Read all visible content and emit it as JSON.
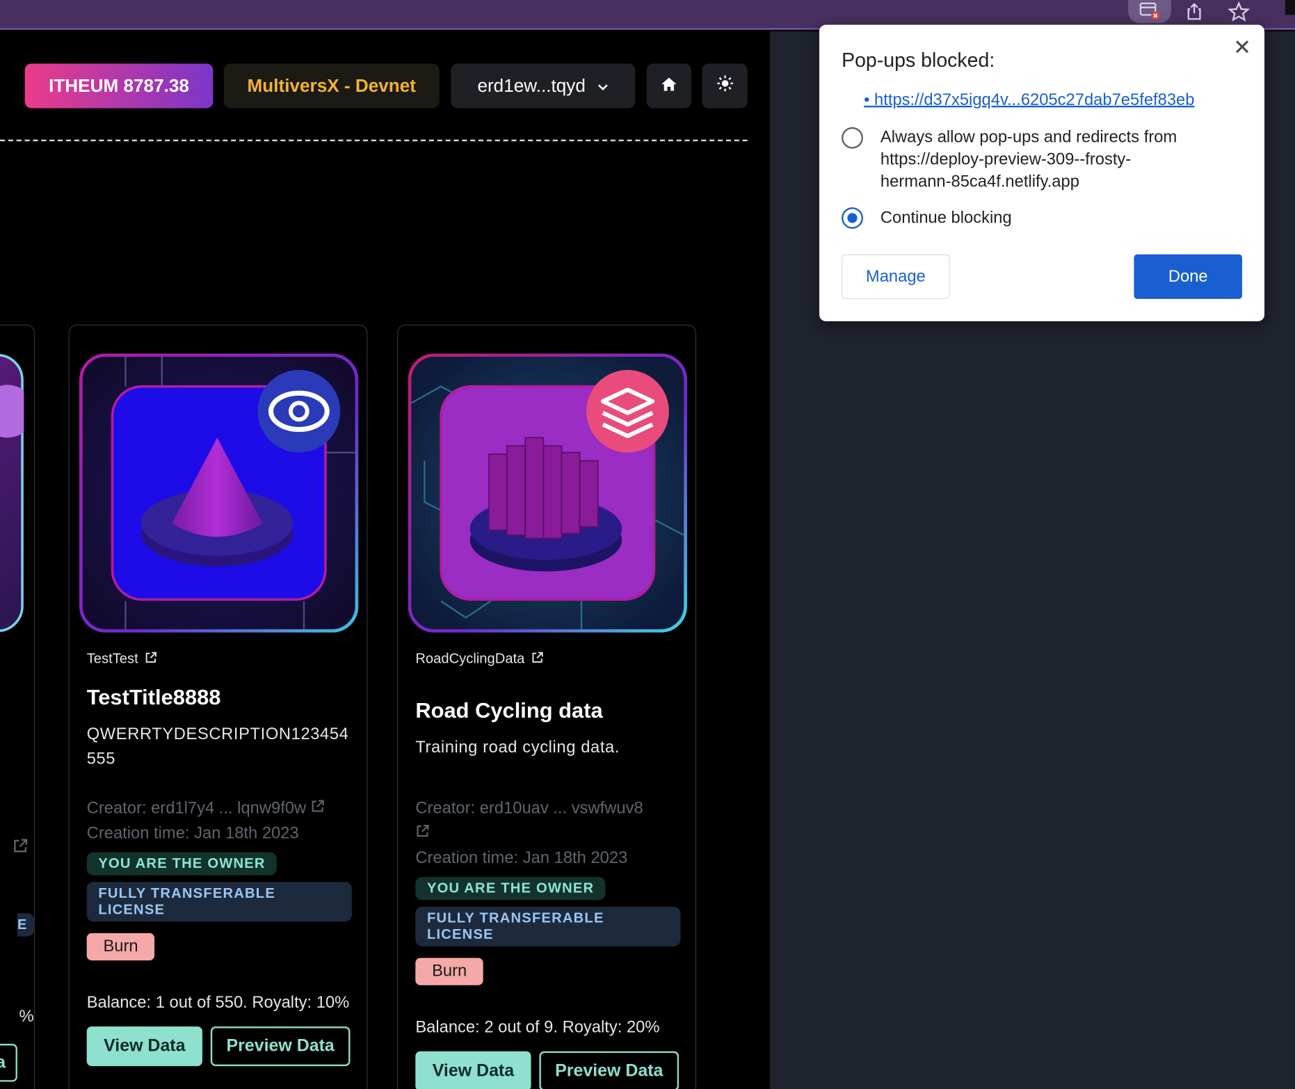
{
  "toolbar": {
    "icons": [
      "popup-blocked-icon",
      "share-icon",
      "bookmark-star-icon"
    ],
    "accent": "#47305f"
  },
  "header": {
    "itheum_balance": "ITHEUM 8787.38",
    "network": "MultiversX - Devnet",
    "wallet": "erd1ew...tqyd"
  },
  "cards": [
    {
      "token": "TestTest",
      "title": "TestTitle8888",
      "description": "QWERRTYDESCRIPTION123454555",
      "creator": "Creator: erd1l7y4 ... lqnw9f0w",
      "creation_time": "Creation time: Jan 18th 2023",
      "owner_badge": "YOU ARE THE OWNER",
      "license_badge": "FULLY TRANSFERABLE LICENSE",
      "burn": "Burn",
      "balance": "Balance: 1 out of 550. Royalty: 10%",
      "view": "View Data",
      "preview": "Preview Data"
    },
    {
      "token": "RoadCyclingData",
      "title": "Road Cycling data",
      "description": "Training road cycling data.",
      "creator": "Creator: erd10uav ... vswfwuv8",
      "creation_time": "Creation time: Jan 18th 2023",
      "owner_badge": "YOU ARE THE OWNER",
      "license_badge": "FULLY TRANSFERABLE LICENSE",
      "burn": "Burn",
      "balance": "Balance: 2 out of 9. Royalty: 20%",
      "view": "View Data",
      "preview": "Preview Data"
    }
  ],
  "partial_card": {
    "license_fragment": "E",
    "royalty_fragment": "%",
    "button_fragment": "a"
  },
  "popup": {
    "title": "Pop-ups blocked:",
    "blocked_link": "https://d37x5igq4v...6205c27dab7e5fef83eb",
    "option_allow_line1": "Always allow pop-ups and redirects from",
    "option_allow_line2": "https://deploy-preview-309--frosty-",
    "option_allow_line3": "hermann-85ca4f.netlify.app",
    "option_block": "Continue blocking",
    "selected": "Continue blocking",
    "manage": "Manage",
    "done": "Done",
    "close": "✕"
  }
}
